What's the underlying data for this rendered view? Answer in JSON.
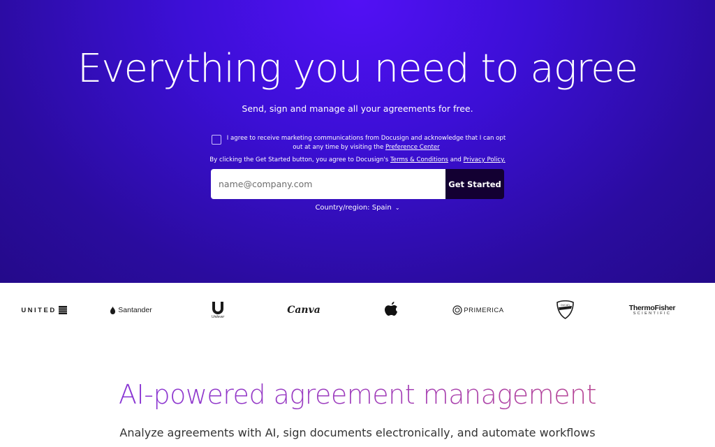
{
  "hero": {
    "title": "Everything you need to agree",
    "subtitle": "Send, sign and manage all your agreements for free.",
    "consent": {
      "text": "I agree to receive marketing communications from Docusign and acknowledge that I can opt out at any time by visiting the ",
      "link": "Preference Center",
      "checked": false
    },
    "legal": {
      "prefix": "By clicking the Get Started button, you agree to Docusign's ",
      "terms_link": "Terms & Conditions",
      "and": " and ",
      "privacy_link": "Privacy Policy."
    },
    "email": {
      "value": "",
      "placeholder": "name@company.com"
    },
    "cta_label": "Get Started",
    "region": {
      "label": "Country/region:",
      "value": "Spain"
    },
    "colors": {
      "background": "#3c0fd6",
      "cta": "#130032"
    }
  },
  "logos": {
    "united": "UNITED",
    "santander": "Santander",
    "unilever": "Unilever",
    "canva": "Canva",
    "apple": "apple-logo",
    "primerica": "PRIMERICA",
    "ducati": "DUCATI",
    "thermo_top": "ThermoFisher",
    "thermo_bottom": "SCIENTIFIC"
  },
  "section": {
    "title": "AI-powered agreement management",
    "subtitle": "Analyze agreements with AI, sign documents electronically, and automate workflows"
  }
}
